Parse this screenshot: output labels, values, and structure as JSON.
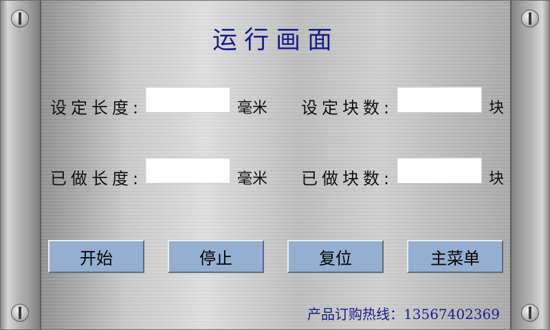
{
  "title": "运行画面",
  "rows": [
    {
      "left_label": "设定长度:",
      "left_unit": "毫米",
      "left_value": "",
      "right_label": "设定块数:",
      "right_unit": "块",
      "right_value": ""
    },
    {
      "left_label": "已做长度:",
      "left_unit": "毫米",
      "left_value": "",
      "right_label": "已做块数:",
      "right_unit": "块",
      "right_value": ""
    }
  ],
  "buttons": {
    "start": "开始",
    "stop": "停止",
    "reset": "复位",
    "main_menu": "主菜单"
  },
  "hotline": "产品订购热线：13567402369",
  "colors": {
    "title": "#1b1b8f",
    "button": "#94afd0",
    "hotline": "#1b1b8f"
  },
  "icons": [
    "screw-icon"
  ]
}
